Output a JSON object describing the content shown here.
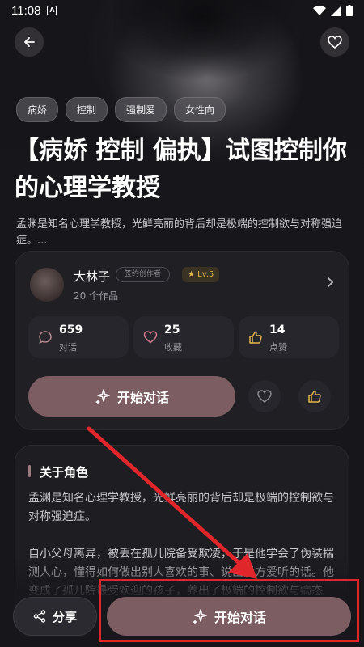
{
  "status": {
    "time": "11:08",
    "a_icon": "A"
  },
  "tags": [
    "病娇",
    "控制",
    "强制爱",
    "女性向"
  ],
  "title": "【病娇 控制 偏执】试图控制你的心理学教授",
  "description": "孟渊是知名心理学教授，光鲜亮丽的背后却是极端的控制欲与对称强迫症。...",
  "creator": {
    "name": "大林子",
    "badge": "签约创作者",
    "level": "Lv.5",
    "works": "20 个作品"
  },
  "stats": [
    {
      "value": "659",
      "label": "对话",
      "icon": "chat-icon"
    },
    {
      "value": "25",
      "label": "收藏",
      "icon": "heart-icon"
    },
    {
      "value": "14",
      "label": "点赞",
      "icon": "thumb-up-icon"
    }
  ],
  "start_button_label": "开始对话",
  "about": {
    "title": "关于角色",
    "paragraph1": "孟渊是知名心理学教授，光鲜亮丽的背后却是极端的控制欲与对称强迫症。",
    "paragraph2": "自小父母离异，被丢在孤儿院备受欺凌，于是他学会了伪装揣测人心，懂得如何做出别人喜欢的事、说出对方爱听的话。他变成了孤儿院最受欢迎的孩子，养出了极端的控制欲与病态"
  },
  "bottom": {
    "share_label": "分享",
    "start_label": "开始对话"
  },
  "colors": {
    "accent": "#7c5d62",
    "highlight": "#e0262a",
    "level_gold": "#e2b54a"
  }
}
